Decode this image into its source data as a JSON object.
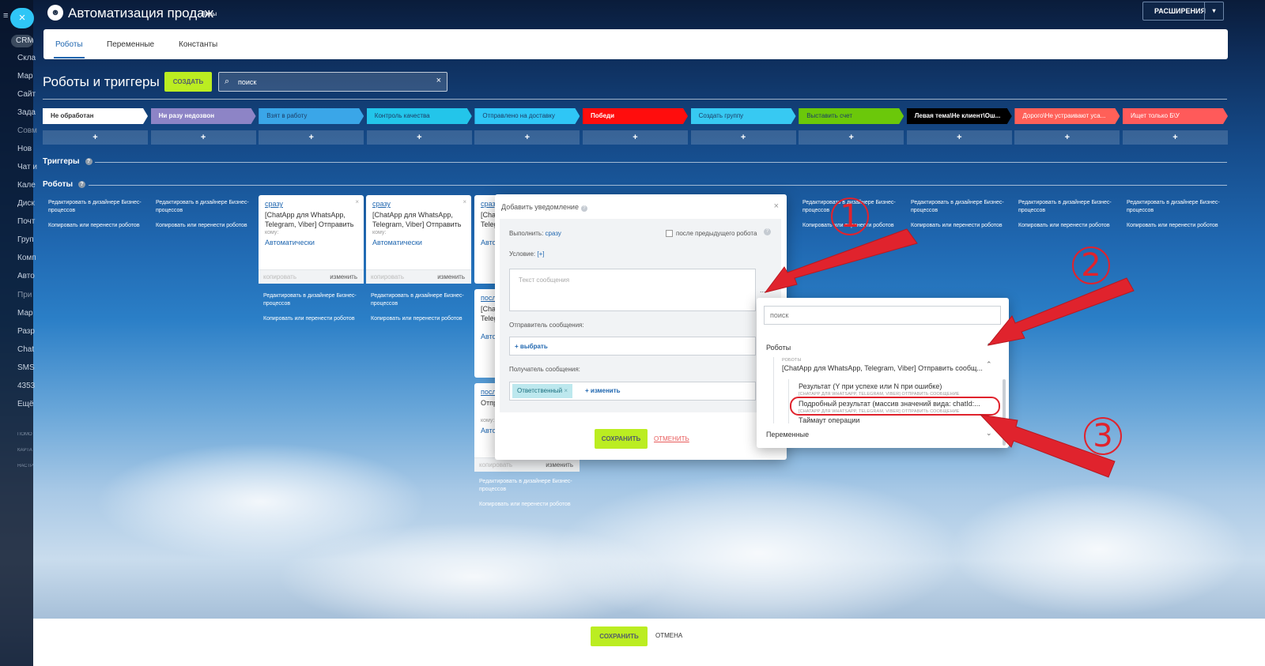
{
  "sidebar": {
    "crm": "CRM",
    "items": [
      "Скла",
      "Мар",
      "Сайт",
      "Зада",
      "Совм",
      "Нов",
      "Чат и",
      "Кале",
      "Диск",
      "Почт",
      "Груп",
      "Комп",
      "Авто",
      "При",
      "Мар",
      "Разр",
      "Chat",
      "SMS",
      "4353",
      "Ещё"
    ],
    "small": [
      "ПОМО",
      "КАРТА",
      "НАСТР"
    ]
  },
  "header": {
    "title": "Автоматизация продаж",
    "subtitle": "Лиды",
    "extensions": "РАСШИРЕНИЯ"
  },
  "tabs": [
    "Роботы",
    "Переменные",
    "Константы"
  ],
  "page": {
    "title": "Роботы и триггеры",
    "create": "СОЗДАТЬ",
    "search_value": "поиск"
  },
  "stages": [
    {
      "label": "Не обработан",
      "bg": "#ffffff",
      "fg": "#333333"
    },
    {
      "label": "Ни разу недозвон",
      "bg": "#8d84c6",
      "fg": "#ffffff"
    },
    {
      "label": "Взят в работу",
      "bg": "#3aa6e8",
      "fg": "#1c3d66"
    },
    {
      "label": "Контроль качества",
      "bg": "#23c5ea",
      "fg": "#1c3d66"
    },
    {
      "label": "Отправлено на доставку",
      "bg": "#2fc6f6",
      "fg": "#1c3d66"
    },
    {
      "label": "Победи",
      "bg": "#ff0d0d",
      "fg": "#ffffff"
    },
    {
      "label": "Создать группу",
      "bg": "#37c9f2",
      "fg": "#1c3d66"
    },
    {
      "label": "Выставить счет",
      "bg": "#6bc80a",
      "fg": "#1c3d66"
    },
    {
      "label": "Левая тема\\Не клиент\\Ош...",
      "bg": "#000000",
      "fg": "#ffffff"
    },
    {
      "label": "Дорого\\Не устраивают уса...",
      "bg": "#ff6058",
      "fg": "#ffffff"
    },
    {
      "label": "Ищет только Б\\У",
      "bg": "#ff5a5a",
      "fg": "#ffffff"
    }
  ],
  "plus": "+",
  "sections": {
    "triggers": "Триггеры",
    "robots": "Роботы",
    "help": "?"
  },
  "links": {
    "edit": "Редактировать в дизайнере Бизнес-процессов",
    "copy": "Копировать или перенести роботов"
  },
  "cards": {
    "when_now": "сразу",
    "when_after": "посл",
    "title": "[ChatApp для WhatsApp, Telegram, Viber] Отправить",
    "title_short": "[Cha Teleg",
    "komu": "кому:",
    "auto": "Автоматически",
    "auto_short": "Авто",
    "copy": "копировать",
    "edit": "изменить",
    "close": "×",
    "otpr": "Отпр"
  },
  "modal": {
    "title": "Добавить уведомление",
    "execute": "Выполнить:",
    "execute_val": "сразу",
    "after_prev": "после предыдущего робота",
    "condition": "Условие:",
    "condition_val": "[+]",
    "text_placeholder": "Текст сообщения",
    "sender": "Отправитель сообщения:",
    "choose": "+ выбрать",
    "recipient": "Получатель сообщения:",
    "responsible": "Ответственный",
    "change": "+ изменить",
    "save": "СОХРАНИТЬ",
    "cancel": "ОТМЕНИТЬ",
    "dots": "..."
  },
  "dropdown": {
    "search_placeholder": "поиск",
    "robots": "Роботы",
    "robots_small": "РОБОТЫ",
    "robot_item": "[ChatApp для WhatsApp, Telegram, Viber] Отправить сообщ...",
    "r1": "Результат (Y при успехе или N при ошибке)",
    "r1_small": "[CHATAPP ДЛЯ WHATSAPP, TELEGRAM, VIBER] ОТПРАВИТЬ СООБЩЕНИЕ",
    "r2": "Подробный результат (массив значений вида: chatId:...",
    "r2_small": "[CHATAPP ДЛЯ WHATSAPP, TELEGRAM, VIBER] ОТПРАВИТЬ СООБЩЕНИЕ",
    "r3": "Таймаут операции",
    "variables": "Переменные"
  },
  "annotations": [
    "1",
    "2",
    "3"
  ],
  "bottom": {
    "save": "СОХРАНИТЬ",
    "cancel": "ОТМЕНА"
  },
  "colors": {
    "accent": "#bbed21",
    "link": "#2067b0",
    "annotation": "#e0232d"
  }
}
